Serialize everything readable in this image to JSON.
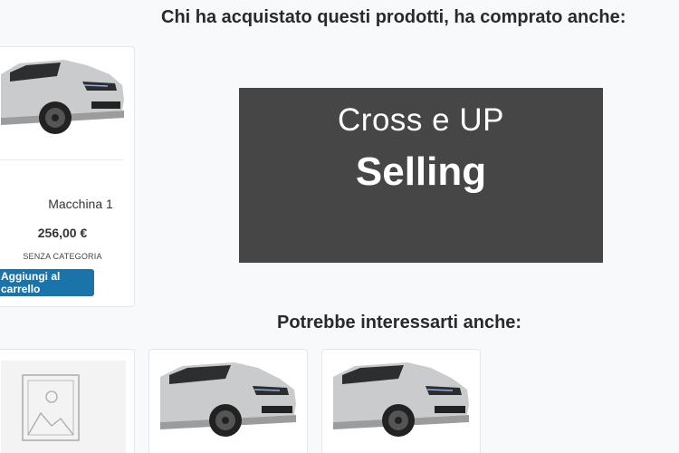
{
  "headings": {
    "bought_also": "Chi ha acquistato questi prodotti, ha comprato anche:",
    "may_interest": "Potrebbe interessarti anche:"
  },
  "product": {
    "name": "Macchina 1",
    "price": "256,00 €",
    "category": "SENZA CATEGORIA",
    "add_to_cart": "Aggiungi al carrello"
  },
  "banner": {
    "line1": "Cross e UP",
    "line2": "Selling"
  },
  "colors": {
    "button": "#1a73a9",
    "banner_bg": "#464646",
    "page_bg": "#f8f9fb"
  },
  "icons": {
    "placeholder": "image-placeholder-icon"
  }
}
